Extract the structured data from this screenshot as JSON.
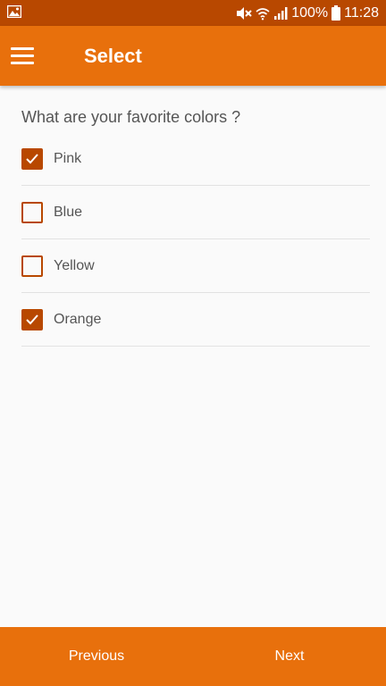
{
  "status_bar": {
    "battery_text": "100%",
    "time": "11:28",
    "icons": [
      "gallery-notification-icon",
      "mute-icon",
      "wifi-icon",
      "signal-icon",
      "battery-icon"
    ]
  },
  "app_bar": {
    "title": "Select",
    "menu_icon": "hamburger-menu-icon"
  },
  "question": "What are your favorite colors ?",
  "options": [
    {
      "label": "Pink",
      "checked": true
    },
    {
      "label": "Blue",
      "checked": false
    },
    {
      "label": "Yellow",
      "checked": false
    },
    {
      "label": "Orange",
      "checked": true
    }
  ],
  "navigation": {
    "previous_label": "Previous",
    "next_label": "Next"
  },
  "colors": {
    "status_bar": "#b84800",
    "app_bar": "#e8700c",
    "checkbox": "#b84800",
    "background": "#fafafa"
  }
}
